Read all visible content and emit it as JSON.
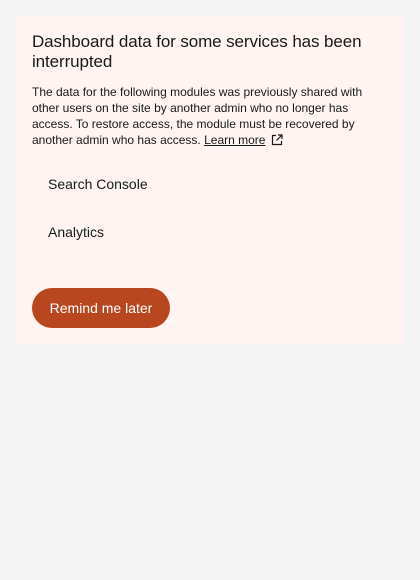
{
  "notice": {
    "title": "Dashboard data for some services has been interrupted",
    "description": "The data for the following modules was previously shared with other users on the site by another admin who no longer has access. To restore access, the module must be recovered by another admin who has access.",
    "learn_more_label": "Learn more",
    "learn_more_icon": "external-link-icon",
    "modules": [
      {
        "label": "Search Console"
      },
      {
        "label": "Analytics"
      }
    ],
    "remind_button_label": "Remind me later",
    "colors": {
      "page_background": "#f3f3f3",
      "notice_background": "#fff4f1",
      "button_background": "#b8461f",
      "button_text": "#ffffff",
      "text": "#161b18"
    }
  }
}
